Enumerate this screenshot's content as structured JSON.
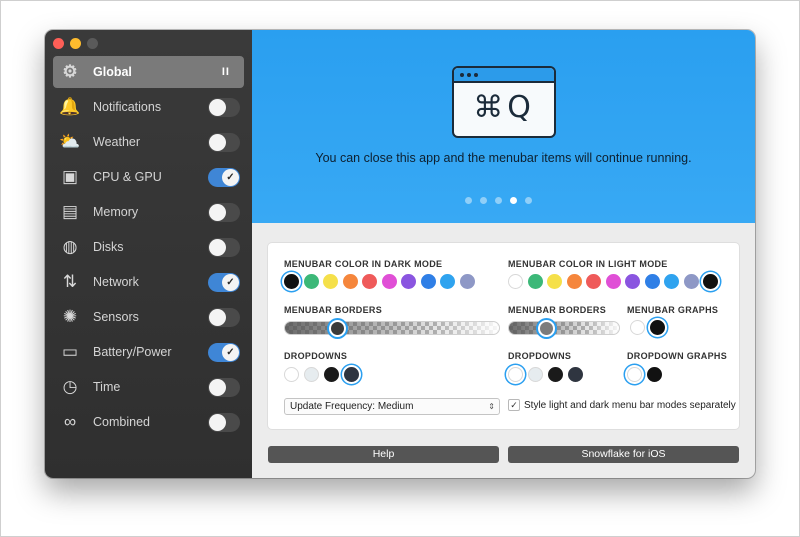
{
  "sidebar": {
    "items": [
      {
        "label": "Global",
        "icon": "gear-icon",
        "glyph": "⚙",
        "control": "pause",
        "control_label": "II"
      },
      {
        "label": "Notifications",
        "icon": "bell-icon",
        "glyph": "🔔",
        "control": "toggle",
        "on": false
      },
      {
        "label": "Weather",
        "icon": "weather-icon",
        "glyph": "⛅",
        "control": "toggle",
        "on": false
      },
      {
        "label": "CPU & GPU",
        "icon": "cpu-icon",
        "glyph": "▣",
        "control": "toggle",
        "on": true
      },
      {
        "label": "Memory",
        "icon": "memory-icon",
        "glyph": "▤",
        "control": "toggle",
        "on": false
      },
      {
        "label": "Disks",
        "icon": "disk-icon",
        "glyph": "◍",
        "control": "toggle",
        "on": false
      },
      {
        "label": "Network",
        "icon": "network-icon",
        "glyph": "⇅",
        "control": "toggle",
        "on": true
      },
      {
        "label": "Sensors",
        "icon": "sensor-icon",
        "glyph": "✺",
        "control": "toggle",
        "on": false
      },
      {
        "label": "Battery/Power",
        "icon": "battery-icon",
        "glyph": "▭",
        "control": "toggle",
        "on": true
      },
      {
        "label": "Time",
        "icon": "clock-icon",
        "glyph": "◷",
        "control": "toggle",
        "on": false
      },
      {
        "label": "Combined",
        "icon": "combined-icon",
        "glyph": "∞",
        "control": "toggle",
        "on": false
      }
    ]
  },
  "banner": {
    "keys": "⌘Q",
    "text": "You can close this app and the menubar items will continue running.",
    "page_count": 5,
    "active_page": 4
  },
  "settings": {
    "dark_color_label": "MENUBAR COLOR IN DARK MODE",
    "light_color_label": "MENUBAR COLOR IN LIGHT MODE",
    "dark_colors": [
      "#111111",
      "#3cb878",
      "#f5e04a",
      "#f5863c",
      "#ef5a5a",
      "#e04fd6",
      "#8a55e0",
      "#2f7fe6",
      "#2fa3ef",
      "#8e98c6"
    ],
    "dark_selected": 0,
    "light_colors": [
      "#ffffff",
      "#3cb878",
      "#f5e04a",
      "#f5863c",
      "#ef5a5a",
      "#e04fd6",
      "#8a55e0",
      "#2f7fe6",
      "#2fa3ef",
      "#8e98c6",
      "#111111"
    ],
    "light_selected": 10,
    "dark_borders_label": "MENUBAR BORDERS",
    "dark_borders_value": 0.22,
    "light_borders_label": "MENUBAR BORDERS",
    "light_borders_value": 0.3,
    "graphs_label": "MENUBAR GRAPHS",
    "graph_colors": [
      "#ffffff",
      "#111111"
    ],
    "graph_selected": 1,
    "dark_dropdowns_label": "DROPDOWNS",
    "dark_dropdowns": [
      "#ffffff",
      "#e6ecef",
      "#1a1a1a",
      "#2f3540"
    ],
    "dark_dropdown_selected": 3,
    "light_dropdowns_label": "DROPDOWNS",
    "light_dropdowns": [
      "#ffffff",
      "#e6ecef",
      "#1a1a1a",
      "#2f3540"
    ],
    "light_dropdown_selected": 0,
    "dropdown_graphs_label": "DROPDOWN GRAPHS",
    "dropdown_graphs": [
      "#ffffff",
      "#111111"
    ],
    "dropdown_graphs_selected": 0,
    "update_frequency": "Update Frequency: Medium",
    "style_separately_label": "Style light and dark menu bar modes separately",
    "style_separately_checked": true
  },
  "buttons": {
    "help": "Help",
    "ios": "Snowflake for iOS"
  },
  "colors": {
    "accent": "#2a9ff0",
    "toggle_on": "#3f86d6",
    "sidebar_bg": "#333333"
  }
}
